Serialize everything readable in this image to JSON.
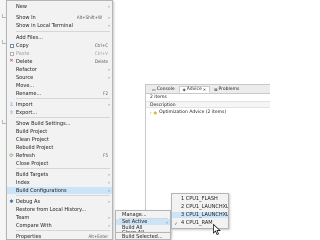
{
  "context_menu": {
    "items": [
      {
        "label": "New",
        "submenu": true
      },
      {
        "label": "Show In",
        "shortcut": "Alt+Shift+W",
        "submenu": true
      },
      {
        "label": "Show in Local Terminal",
        "submenu": true
      },
      {
        "label": "Add Files..."
      },
      {
        "label": "Copy",
        "shortcut": "Ctrl+C",
        "icon": "copy-icon"
      },
      {
        "label": "Paste",
        "shortcut": "Ctrl+V",
        "icon": "paste-icon",
        "disabled": true
      },
      {
        "label": "Delete",
        "shortcut": "Delete",
        "icon": "delete-icon"
      },
      {
        "label": "Refactor",
        "submenu": true
      },
      {
        "label": "Source",
        "submenu": true
      },
      {
        "label": "Move..."
      },
      {
        "label": "Rename...",
        "shortcut": "F2"
      },
      {
        "label": "Import",
        "icon": "import-icon",
        "submenu": true
      },
      {
        "label": "Export...",
        "icon": "export-icon"
      },
      {
        "label": "Show Build Settings..."
      },
      {
        "label": "Build Project"
      },
      {
        "label": "Clean Project"
      },
      {
        "label": "Rebuild Project"
      },
      {
        "label": "Refresh",
        "shortcut": "F5",
        "icon": "refresh-icon"
      },
      {
        "label": "Close Project"
      },
      {
        "label": "Build Targets",
        "submenu": true
      },
      {
        "label": "Index",
        "submenu": true
      },
      {
        "label": "Build Configurations",
        "submenu": true,
        "highlighted": true
      },
      {
        "label": "Debug As",
        "icon": "debug-icon",
        "submenu": true
      },
      {
        "label": "Restore from Local History..."
      },
      {
        "label": "Team",
        "submenu": true
      },
      {
        "label": "Compare With",
        "submenu": true
      },
      {
        "label": "Properties",
        "shortcut": "Alt+Enter"
      }
    ]
  },
  "build_config_menu": {
    "items": [
      {
        "label": "Manage..."
      },
      {
        "label": "Set Active",
        "submenu": true,
        "highlighted": true
      },
      {
        "label": "Build All"
      },
      {
        "label": "Clean All"
      },
      {
        "label": "Build Selected..."
      }
    ]
  },
  "set_active_menu": {
    "items": [
      {
        "label": "1 CPU1_FLASH"
      },
      {
        "label": "2 CPU1_LAUNCHXL_FLASH"
      },
      {
        "label": "3 CPU1_LAUNCHXL_RAM",
        "highlighted": true
      },
      {
        "label": "4 CPU1_RAM",
        "checked": true
      }
    ]
  },
  "views": {
    "tabs": [
      {
        "label": "Console",
        "icon": "console-icon"
      },
      {
        "label": "Advice",
        "icon": "advice-icon",
        "active": true,
        "close": "×"
      },
      {
        "label": "Problems",
        "icon": "problems-icon"
      }
    ],
    "item_count": "2 items",
    "column_header": "Description",
    "rows": [
      {
        "label": "Optimization Advice (2 items)",
        "expander": "›",
        "icon": "lightbulb-icon"
      }
    ]
  },
  "glyphs": {
    "submenu_arrow": "›",
    "checkmark": "✓",
    "delete": "✕",
    "import": "⇩",
    "export": "⇧",
    "refresh": "⟳",
    "debug": "✱"
  },
  "colors": {
    "menu_bg": "#f2f2f2",
    "highlight": "#cce4f7",
    "disabled_text": "#a0a0a0"
  }
}
